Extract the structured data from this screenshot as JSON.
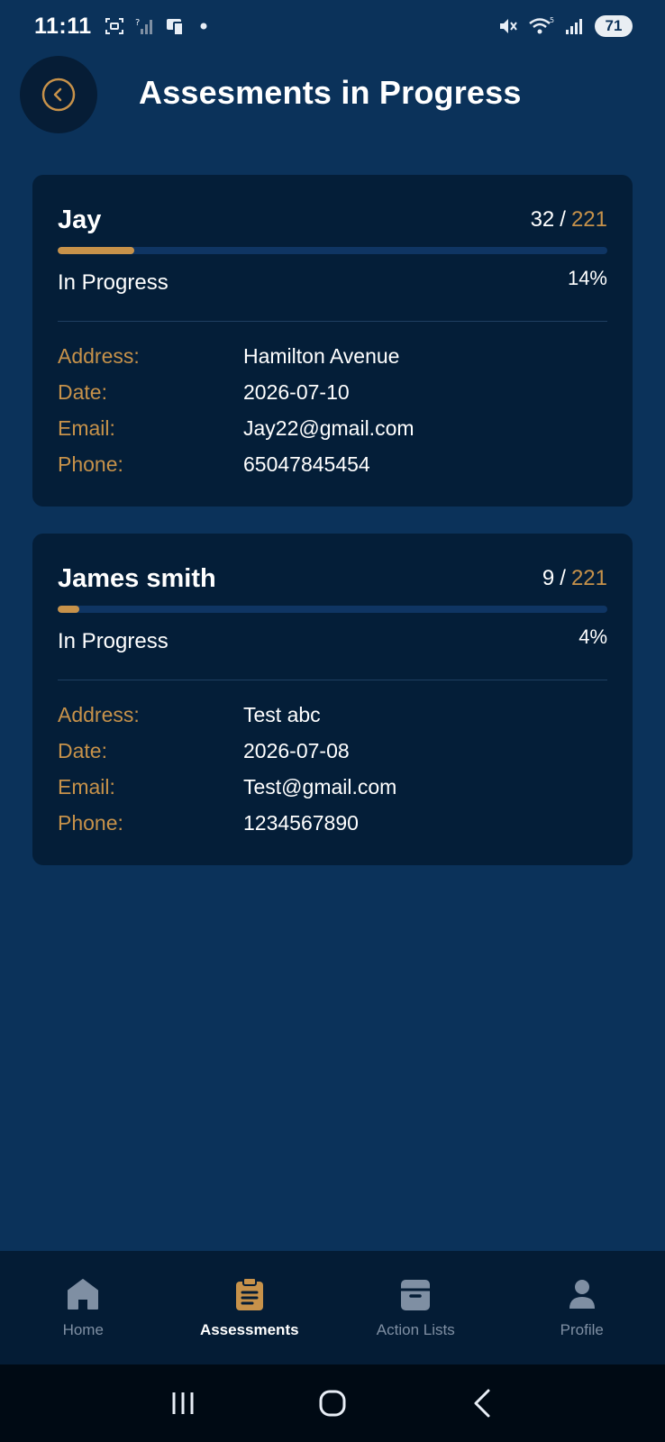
{
  "status_bar": {
    "time": "11:11",
    "battery": "71"
  },
  "header": {
    "title": "Assesments in Progress"
  },
  "cards": [
    {
      "name": "Jay",
      "completed": "32",
      "separator": "/",
      "total": "221",
      "progress_fraction": 0.14,
      "status": "In Progress",
      "percent": "14%",
      "fields": [
        {
          "label": "Address:",
          "value": "Hamilton Avenue"
        },
        {
          "label": "Date:",
          "value": "2026-07-10"
        },
        {
          "label": "Email:",
          "value": "Jay22@gmail.com"
        },
        {
          "label": "Phone:",
          "value": "65047845454"
        }
      ]
    },
    {
      "name": "James smith",
      "completed": "9",
      "separator": "/",
      "total": "221",
      "progress_fraction": 0.04,
      "status": "In Progress",
      "percent": "4%",
      "fields": [
        {
          "label": "Address:",
          "value": "Test abc"
        },
        {
          "label": "Date:",
          "value": "2026-07-08"
        },
        {
          "label": "Email:",
          "value": "Test@gmail.com"
        },
        {
          "label": "Phone:",
          "value": "1234567890"
        }
      ]
    }
  ],
  "bottom_nav": {
    "items": [
      {
        "label": "Home",
        "icon": "home-icon"
      },
      {
        "label": "Assessments",
        "icon": "clipboard-icon",
        "active": true
      },
      {
        "label": "Action Lists",
        "icon": "archive-icon"
      },
      {
        "label": "Profile",
        "icon": "person-icon"
      }
    ]
  },
  "colors": {
    "background": "#0b325a",
    "card": "#041e38",
    "accent": "#c7924a",
    "inactive": "#7f8fa3"
  }
}
